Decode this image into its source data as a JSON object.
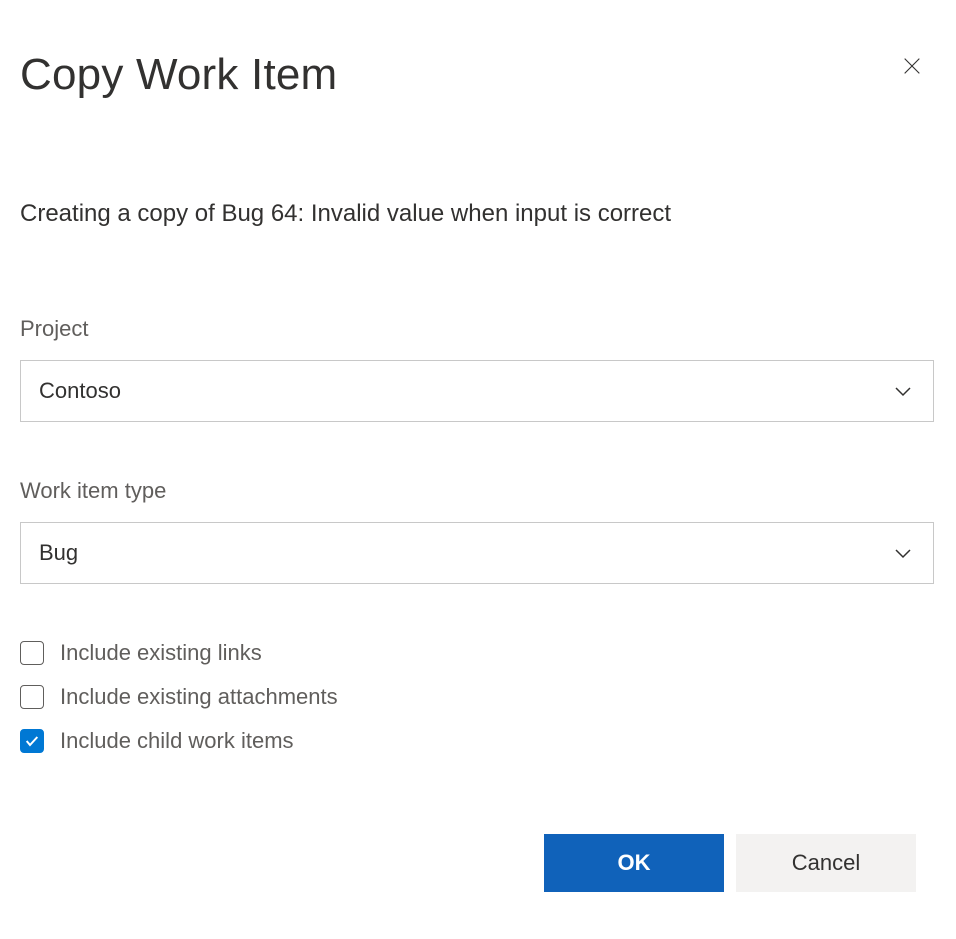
{
  "dialog": {
    "title": "Copy Work Item",
    "subtitle": "Creating a copy of Bug 64: Invalid value when input is correct"
  },
  "fields": {
    "project": {
      "label": "Project",
      "value": "Contoso"
    },
    "workItemType": {
      "label": "Work item type",
      "value": "Bug"
    }
  },
  "options": {
    "includeLinks": {
      "label": "Include existing links",
      "checked": false
    },
    "includeAttachments": {
      "label": "Include existing attachments",
      "checked": false
    },
    "includeChildren": {
      "label": "Include child work items",
      "checked": true
    }
  },
  "buttons": {
    "ok": "OK",
    "cancel": "Cancel"
  }
}
